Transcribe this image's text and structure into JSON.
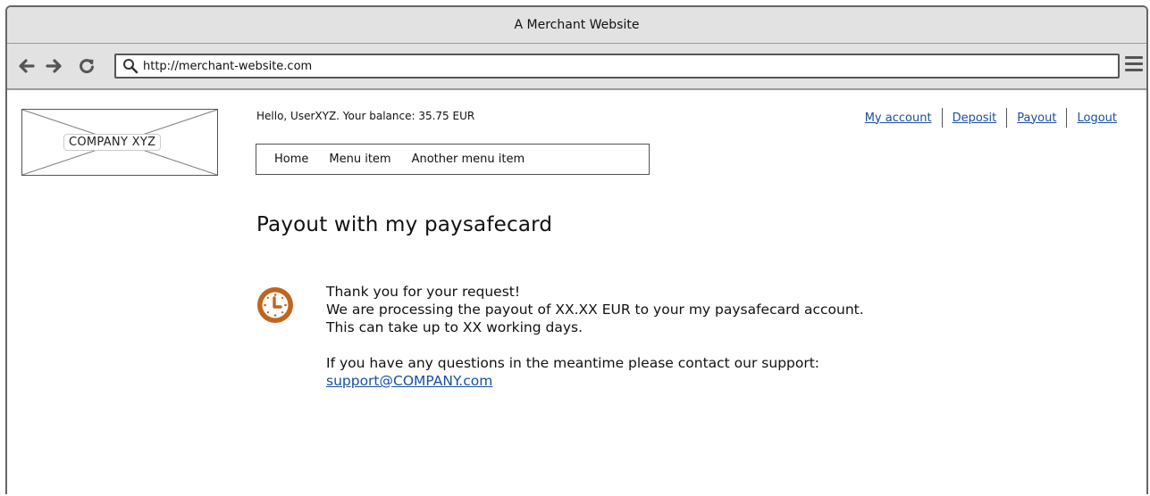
{
  "window": {
    "title": "A Merchant Website"
  },
  "browser": {
    "url": "http://merchant-website.com",
    "icons": [
      "back-arrow-icon",
      "forward-arrow-icon",
      "reload-icon",
      "search-icon",
      "hamburger-menu-icon"
    ]
  },
  "header": {
    "logo_text": "COMPANY XYZ",
    "greeting": "Hello, UserXYZ. Your balance: 35.75 EUR",
    "account_links": [
      "My account",
      "Deposit",
      "Payout",
      "Logout"
    ]
  },
  "menu": {
    "items": [
      "Home",
      "Menu item",
      "Another menu item"
    ]
  },
  "main": {
    "title": "Payout with my paysafecard",
    "status_icon": "clock-icon",
    "status_color": "#c0651f",
    "link_color": "#1a4fa0",
    "lines": [
      "Thank you for your request!",
      "We are processing the payout of XX.XX EUR to your my paysafecard account.",
      "This can take up to XX working days."
    ],
    "support_text": "If you have any questions in the meantime please contact our support:",
    "support_email": "support@COMPANY.com"
  }
}
